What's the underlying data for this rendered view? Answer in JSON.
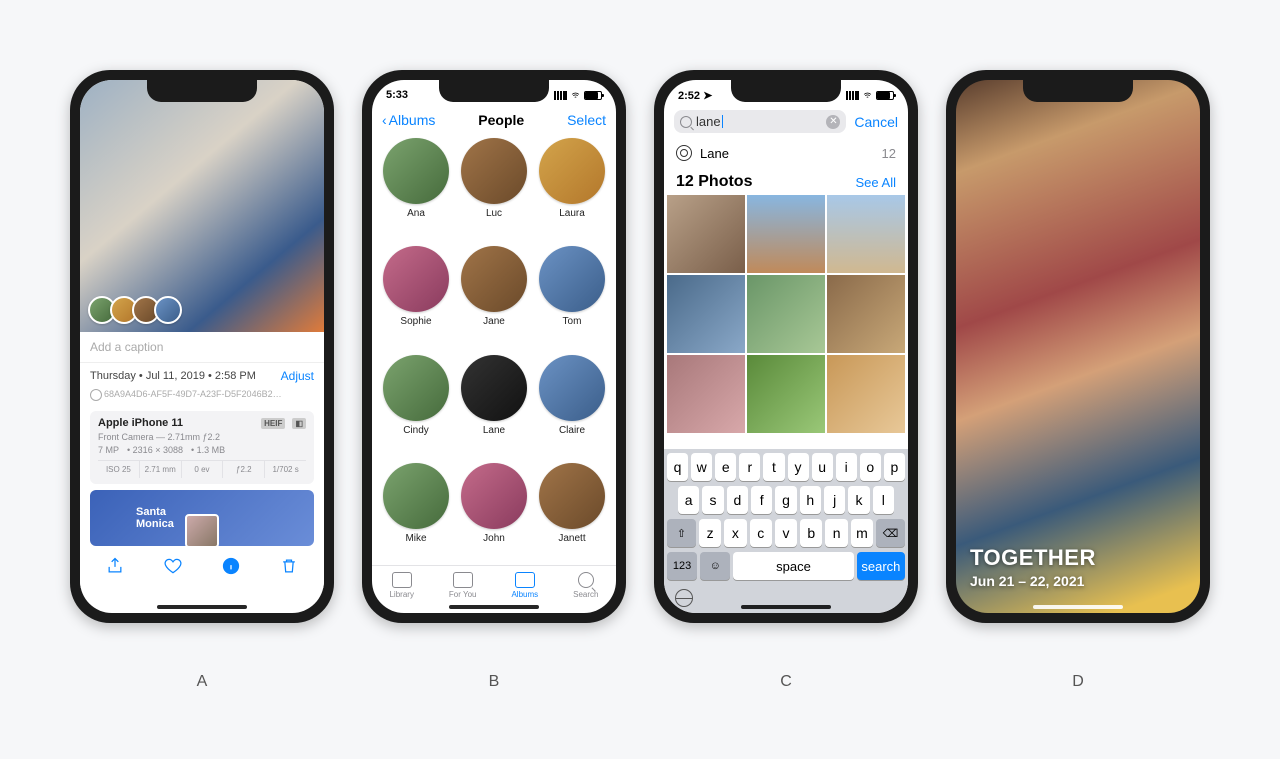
{
  "labels": {
    "a": "A",
    "b": "B",
    "c": "C",
    "d": "D"
  },
  "phoneA": {
    "caption_placeholder": "Add a caption",
    "date_line": "Thursday • Jul 11, 2019 • 2:58 PM",
    "adjust": "Adjust",
    "uuid": "68A9A4D6-AF5F-49D7-A23F-D5F2046B2…",
    "device": "Apple iPhone 11",
    "badge_heif": "HEIF",
    "camera_line": "Front Camera — 2.71mm ƒ2.2",
    "mp": "7 MP",
    "res": "2316 × 3088",
    "size": "1.3 MB",
    "iso": "ISO 25",
    "focal": "2.71 mm",
    "ev": "0 ev",
    "fstop": "ƒ2.2",
    "shutter": "1/702 s",
    "map_title": "Santa\nMonica"
  },
  "phoneB": {
    "time": "5:33",
    "back": "Albums",
    "title": "People",
    "select": "Select",
    "people": [
      "Ana",
      "Luc",
      "Laura",
      "Sophie",
      "Jane",
      "Tom",
      "Cindy",
      "Lane",
      "Claire",
      "Mike",
      "John",
      "Janett"
    ],
    "tabs": {
      "library": "Library",
      "for_you": "For You",
      "albums": "Albums",
      "search": "Search"
    }
  },
  "phoneC": {
    "time": "2:52",
    "query": "lane",
    "cancel": "Cancel",
    "suggestion_name": "Lane",
    "suggestion_count": "12",
    "header": "12 Photos",
    "see_all": "See All",
    "keys_r1": [
      "q",
      "w",
      "e",
      "r",
      "t",
      "y",
      "u",
      "i",
      "o",
      "p"
    ],
    "keys_r2": [
      "a",
      "s",
      "d",
      "f",
      "g",
      "h",
      "j",
      "k",
      "l"
    ],
    "keys_r3": [
      "z",
      "x",
      "c",
      "v",
      "b",
      "n",
      "m"
    ],
    "shift": "⇧",
    "back": "⌫",
    "numkey": "123",
    "emoji": "☺",
    "space": "space",
    "search": "search"
  },
  "phoneD": {
    "title": "TOGETHER",
    "date": "Jun 21 – 22, 2021"
  }
}
